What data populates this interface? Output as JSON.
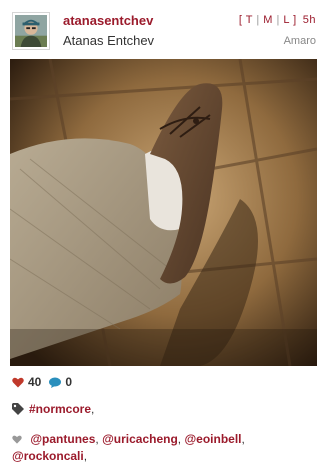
{
  "post": {
    "username": "atanasentchev",
    "full_name": "Atanas Entchev",
    "links": [
      "T",
      "M",
      "L"
    ],
    "age": "5h",
    "filter": "Amaro",
    "avatar_icon": "user-avatar",
    "photo_icon": "photo-of-moccasin-shoe"
  },
  "stats": {
    "likes": "40",
    "comments": "0",
    "like_color": "#c0392b",
    "comment_color": "#2a8fbd"
  },
  "tags": {
    "icon": "tag-icon",
    "items": [
      "#normcore"
    ]
  },
  "likers": {
    "icon": "heart-icon",
    "items": [
      "@pantunes",
      "@uricacheng",
      "@eoinbell",
      "@rockoncali"
    ]
  },
  "theme": {
    "accent": "#9b1b2c"
  }
}
